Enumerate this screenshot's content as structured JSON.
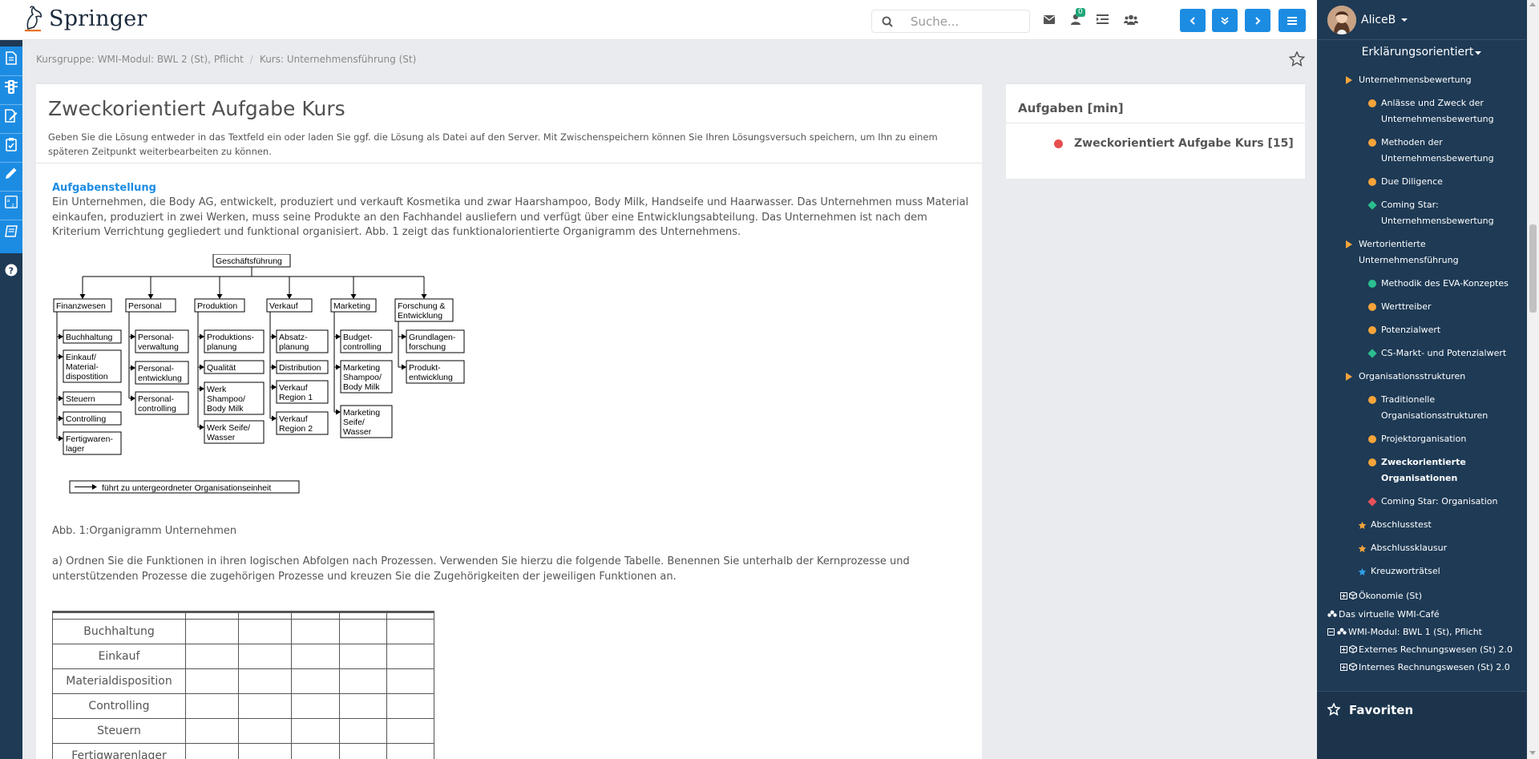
{
  "topbar": {
    "logo_text": "Springer",
    "search_placeholder": "Suche...",
    "notification_count": "0"
  },
  "breadcrumb": {
    "items": [
      "Kursgruppe: WMI-Modul: BWL 2 (St), Pflicht",
      "Kurs: Unternehmensführung (St)"
    ]
  },
  "main": {
    "title": "Zweckorientiert Aufgabe Kurs",
    "intro": "Geben Sie die Lösung entweder in das Textfeld ein oder laden Sie ggf. die Lösung als Datei auf den Server. Mit Zwischenspeichern können Sie Ihren Lösungsversuch speichern, um Ihn zu einem späteren Zeitpunkt weiterbearbeiten zu können.",
    "section_heading": "Aufgabenstellung",
    "section_text": "Ein Unternehmen, die Body AG, entwickelt, produziert und verkauft Kosmetika und zwar Haarshampoo, Body Milk, Handseife und Haarwasser. Das Unternehmen muss Material einkaufen, produziert in zwei Werken, muss seine Produkte an den Fachhandel ausliefern und verfügt über eine Entwicklungsabteilung. Das Unternehmen ist nach dem Kriterium Verrichtung gegliedert und funktional organisiert. Abb. 1 zeigt das funktionalorientierte Organigramm des Unternehmens.",
    "figure_caption": "Abb. 1:Organigramm Unternehmen",
    "question_a": "a) Ordnen Sie die Funktionen in ihren logischen Abfolgen nach Prozessen. Verwenden Sie hierzu die folgende Tabelle. Benennen Sie unterhalb der Kernprozesse und unterstützenden Prozesse die zugehörigen Prozesse und kreuzen Sie die Zugehörigkeiten der jeweiligen Funktionen an.",
    "table_rows": [
      "Buchhaltung",
      "Einkauf",
      "Materialdisposition",
      "Controlling",
      "Steuern",
      "Fertigwarenlager"
    ]
  },
  "orgchart": {
    "root": "Geschäftsführung",
    "departments": [
      {
        "name": [
          "Finanzwesen"
        ],
        "units": [
          [
            "Buchhaltung"
          ],
          [
            "Einkauf/",
            "Material-",
            "dispostition"
          ],
          [
            "Steuern"
          ],
          [
            "Controlling"
          ],
          [
            "Fertigwaren-",
            "lager"
          ]
        ]
      },
      {
        "name": [
          "Personal"
        ],
        "units": [
          [
            "Personal-",
            "verwaltung"
          ],
          [
            "Personal-",
            "entwicklung"
          ],
          [
            "Personal-",
            "controlling"
          ]
        ]
      },
      {
        "name": [
          "Produktion"
        ],
        "units": [
          [
            "Produktions-",
            "planung"
          ],
          [
            "Qualität"
          ],
          [
            "Werk",
            "Shampoo/",
            "Body Milk"
          ],
          [
            "Werk Seife/",
            "Wasser"
          ]
        ]
      },
      {
        "name": [
          "Verkauf"
        ],
        "units": [
          [
            "Absatz-",
            "planung"
          ],
          [
            "Distribution"
          ],
          [
            "Verkauf",
            "Region 1"
          ],
          [
            "Verkauf",
            "Region 2"
          ]
        ]
      },
      {
        "name": [
          "Marketing"
        ],
        "units": [
          [
            "Budget-",
            "controlling"
          ],
          [
            "Marketing",
            "Shampoo/",
            "Body Milk"
          ],
          [
            "Marketing",
            "Seife/",
            "Wasser"
          ]
        ]
      },
      {
        "name": [
          "Forschung &",
          "Entwicklung"
        ],
        "units": [
          [
            "Grundlagen-",
            "forschung"
          ],
          [
            "Produkt-",
            "entwicklung"
          ]
        ]
      }
    ],
    "legend": "führt zu untergeordneter Organisationseinheit"
  },
  "tasks_panel": {
    "title": "Aufgaben [min]",
    "items": [
      {
        "label": "Zweckorientiert Aufgabe Kurs [15]",
        "status_color": "#e84e4e"
      }
    ]
  },
  "sidebar": {
    "user_name": "AliceB",
    "mode": "Erklärungsorientiert",
    "items": [
      {
        "label": "Unternehmensbewertung",
        "icon": "triangle-orange"
      },
      {
        "label": "Anlässe und Zweck der Unternehmensbewertung",
        "icon": "dot-orange"
      },
      {
        "label": "Methoden der Unternehmensbewertung",
        "icon": "dot-orange"
      },
      {
        "label": "Due Diligence",
        "icon": "dot-orange"
      },
      {
        "label": "Coming Star: Unternehmensbewertung",
        "icon": "diamond-green"
      },
      {
        "label": "Wertorientierte Unternehmensführung",
        "icon": "triangle-orange"
      },
      {
        "label": "Methodik des EVA-Konzeptes",
        "icon": "dot-green"
      },
      {
        "label": "Werttreiber",
        "icon": "dot-orange"
      },
      {
        "label": "Potenzialwert",
        "icon": "dot-orange"
      },
      {
        "label": "CS-Markt- und Potenzialwert",
        "icon": "diamond-green"
      },
      {
        "label": "Organisationsstrukturen",
        "icon": "triangle-orange"
      },
      {
        "label": "Traditionelle Organisationsstrukturen",
        "icon": "dot-orange"
      },
      {
        "label": "Projektorganisation",
        "icon": "dot-orange"
      },
      {
        "label": "Zweckorientierte Organisationen",
        "icon": "dot-orange"
      },
      {
        "label": "Coming Star: Organisation",
        "icon": "diamond-red"
      },
      {
        "label": "Abschlusstest",
        "icon": "star-orange"
      },
      {
        "label": "Abschlussklausur",
        "icon": "star-orange"
      },
      {
        "label": "Kreuzworträtsel",
        "icon": "star-blue"
      }
    ],
    "tree": [
      {
        "label": "Ökonomie (St)"
      },
      {
        "label": "Das virtuelle WMI-Café"
      },
      {
        "label": "WMI-Modul: BWL 1 (St), Pflicht"
      },
      {
        "label": "Externes Rechnungswesen (St) 2.0"
      },
      {
        "label": "Internes Rechnungswesen (St) 2.0"
      }
    ],
    "favorites_title": "Favoriten"
  }
}
